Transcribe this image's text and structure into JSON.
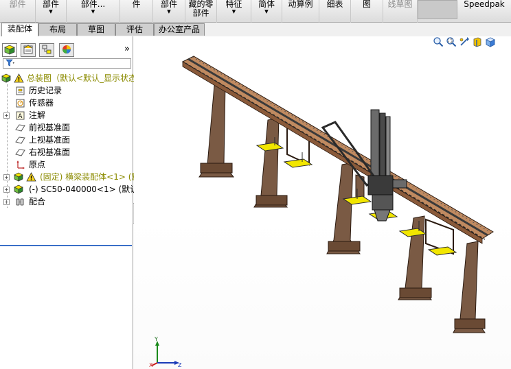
{
  "ribbon": {
    "items": [
      {
        "label": "部件",
        "gray": true
      },
      {
        "label": "部件",
        "arrow": "▼"
      },
      {
        "label": "部件...",
        "arrow": "▼"
      },
      {
        "label": "件"
      },
      {
        "label": "部件",
        "arrow": "▼"
      },
      {
        "label": "藏的零",
        "label2": "部件"
      },
      {
        "label": "特征",
        "arrow": "▼"
      },
      {
        "label": "简体",
        "arrow": "▼"
      },
      {
        "label": "动算例"
      },
      {
        "label": "细表"
      },
      {
        "label": "图"
      },
      {
        "label": "线草图",
        "gray": true
      },
      {
        "label": "Speedpak"
      }
    ]
  },
  "tabs": [
    "装配体",
    "布局",
    "草图",
    "评估",
    "办公室产品"
  ],
  "panel": {
    "more": "»",
    "filter_icon": "filter-icon",
    "tree": [
      {
        "label": "总装图（默认<默认_显示状态",
        "icon": "assembly-warning-icon",
        "olive": true
      },
      {
        "label": "历史记录",
        "icon": "history-icon"
      },
      {
        "label": "传感器",
        "icon": "sensor-icon"
      },
      {
        "label": "注解",
        "icon": "annotation-icon",
        "expand": "+"
      },
      {
        "label": "前视基准面",
        "icon": "plane-icon"
      },
      {
        "label": "上视基准面",
        "icon": "plane-icon"
      },
      {
        "label": "右视基准面",
        "icon": "plane-icon"
      },
      {
        "label": "原点",
        "icon": "origin-icon"
      },
      {
        "label": "(固定) 横梁装配体<1> (默",
        "icon": "subassembly-warning-icon",
        "expand": "+",
        "olive": true
      },
      {
        "label": "(-) SC50-040000<1> (默认",
        "icon": "subassembly-icon",
        "expand": "+"
      },
      {
        "label": "配合",
        "icon": "mates-icon",
        "expand": "+"
      }
    ]
  },
  "viewport": {
    "tools": [
      "zoom-to-fit-icon",
      "zoom-area-icon",
      "previous-view-icon",
      "section-view-icon",
      "view-orientation-icon"
    ],
    "triad": {
      "y": "Y",
      "x": "X",
      "z": "Z"
    }
  },
  "colors": {
    "beam": "#c08a60",
    "leg": "#7a5a44",
    "platform": "#f2e600",
    "steel": "#3a3a3a",
    "selection": "#3a6fc8"
  }
}
